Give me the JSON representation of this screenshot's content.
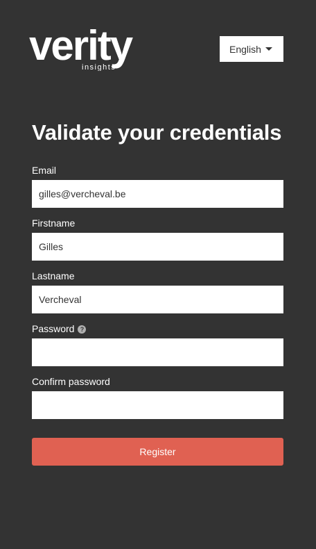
{
  "header": {
    "logo": {
      "wordmark": "verity",
      "tagline": "insights"
    },
    "language": {
      "selected": "English"
    }
  },
  "form": {
    "title": "Validate your credentials",
    "fields": {
      "email": {
        "label": "Email",
        "value": "gilles@vercheval.be"
      },
      "firstname": {
        "label": "Firstname",
        "value": "Gilles"
      },
      "lastname": {
        "label": "Lastname",
        "value": "Vercheval"
      },
      "password": {
        "label": "Password",
        "value": "",
        "help_icon": "question-circle-icon"
      },
      "confirm_password": {
        "label": "Confirm password",
        "value": ""
      }
    },
    "submit_label": "Register"
  },
  "colors": {
    "background": "#333333",
    "accent": "#e06152",
    "input_background": "#ffffff",
    "text": "#ffffff"
  }
}
